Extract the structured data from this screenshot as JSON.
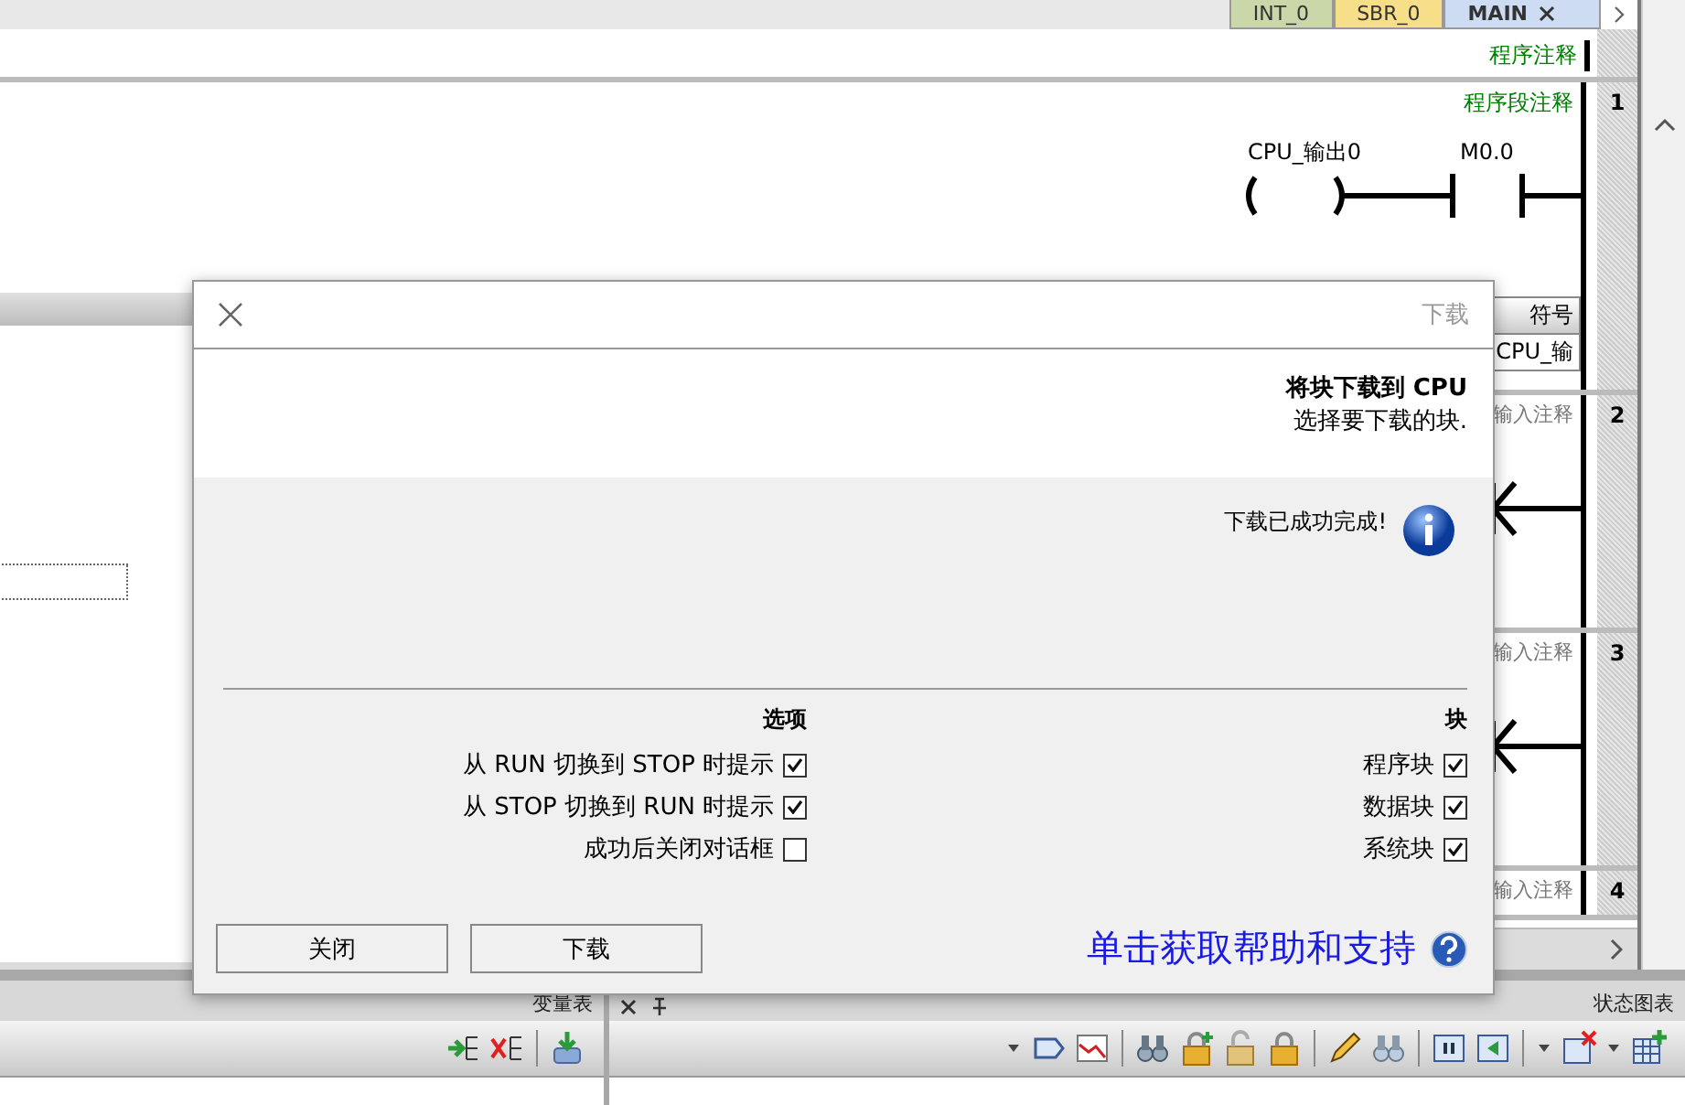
{
  "tabs": [
    {
      "label": "INT_0",
      "selected": false,
      "color": "#c9d7a9"
    },
    {
      "label": "SBR_0",
      "selected": false,
      "color": "#f7df8a"
    },
    {
      "label": "MAIN",
      "selected": true,
      "color": "#cddcf2"
    }
  ],
  "program_comment": "程序注释",
  "networks": [
    {
      "number": "1",
      "comment": "程序段注释",
      "kind": "ladder",
      "contact": "M0.0",
      "coil": "CPU_输出0"
    },
    {
      "number": "2",
      "comment": "输入注释",
      "kind": "stub"
    },
    {
      "number": "3",
      "comment": "输入注释",
      "kind": "stub"
    },
    {
      "number": "4",
      "comment": "输入注释",
      "kind": "header"
    }
  ],
  "symbol_table": {
    "header": "符号",
    "cell": "CPU_输"
  },
  "dialog": {
    "title": "下载",
    "heading": "将块下载到 CPU",
    "subheading": "选择要下载的块.",
    "message": "下载已成功完成!",
    "blocks": {
      "heading": "块",
      "items": [
        {
          "label": "程序块",
          "checked": true
        },
        {
          "label": "数据块",
          "checked": true
        },
        {
          "label": "系统块",
          "checked": true
        }
      ]
    },
    "options": {
      "heading": "选项",
      "items": [
        {
          "label": "从 RUN 切换到 STOP 时提示",
          "checked": true
        },
        {
          "label": "从 STOP 切换到 RUN 时提示",
          "checked": true
        },
        {
          "label": "成功后关闭对话框",
          "checked": false
        }
      ]
    },
    "help_link": "单击获取帮助和支持",
    "buttons": [
      "关闭",
      "下载"
    ]
  },
  "variable_table": {
    "title": "变量表"
  },
  "status_chart": {
    "title": "状态图表"
  }
}
